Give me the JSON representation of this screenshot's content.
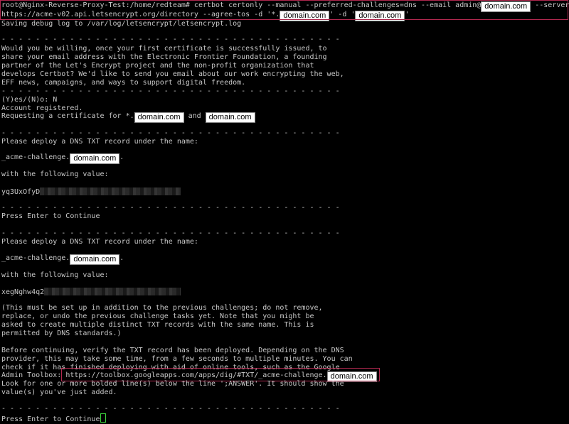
{
  "terminal": {
    "cmd_prefix": "root@Nginx-Reverse-Proxy-Test:/home/redteam# certbot certonly --manual --preferred-challenges=dns --email admin@",
    "cmd_suffix": " --server",
    "cmd_line2_a": "https://acme-v02.api.letsencrypt.org/directory --agree-tos -d '*.",
    "cmd_line2_b": "' -d '",
    "cmd_line2_c": "'",
    "redacted_domain": "domain.com",
    "debug_log": "Saving debug log to /var/log/letsencrypt/letsencrypt.log",
    "separator": "- - - - - - - - - - - - - - - - - - - - - - - - - - - - - - - - - - - - - - - -",
    "eff_lines": [
      "Would you be willing, once your first certificate is successfully issued, to",
      "share your email address with the Electronic Frontier Foundation, a founding",
      "partner of the Let's Encrypt project and the non-profit organization that",
      "develops Certbot? We'd like to send you email about our work encrypting the web,",
      "EFF news, campaigns, and ways to support digital freedom."
    ],
    "prompt_yes_no": "(Y)es/(N)o: N",
    "account_registered": "Account registered.",
    "requesting_prefix": "Requesting a certificate for *.",
    "requesting_and": " and ",
    "deploy_prompt": "Please deploy a DNS TXT record under the name:",
    "acme_prefix": "_acme-challenge.",
    "acme_suffix": ".",
    "following_value": "with the following value:",
    "value1_prefix": "yq3UxOfyD",
    "value2_prefix": "xegNghw4q2",
    "press_enter": "Press Enter to Continue",
    "must_lines": [
      "(This must be set up in addition to the previous challenges; do not remove,",
      "replace, or undo the previous challenge tasks yet. Note that you might be",
      "asked to create multiple distinct TXT records with the same name. This is",
      "permitted by DNS standards.)"
    ],
    "verify_lines": [
      "Before continuing, verify the TXT record has been deployed. Depending on the DNS",
      "provider, this may take some time, from a few seconds to multiple minutes. You can",
      "check if it has finished deploying with aid of online tools, such as the Google"
    ],
    "admin_toolbox_prefix": "Admin Toolbox: ",
    "toolbox_url": "https://toolbox.googleapps.com/apps/dig/#TXT/_acme-challenge.",
    "look_lines": [
      "Look for one or more bolded line(s) below the line ';ANSWER'. It should show the",
      "value(s) you've just added."
    ]
  },
  "colors": {
    "highlight": "#b0284e",
    "cursor": "#3cd23c"
  }
}
